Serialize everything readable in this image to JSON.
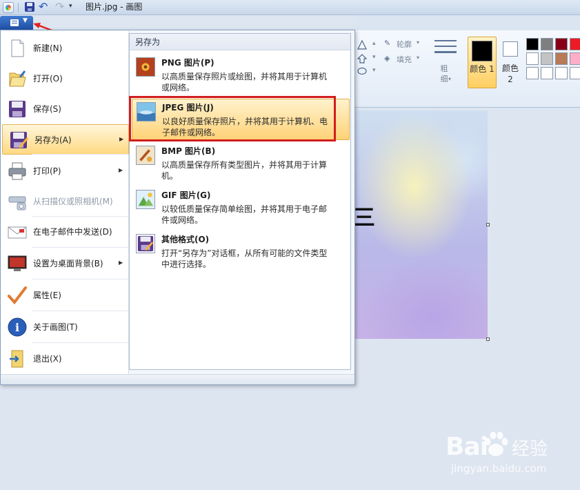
{
  "window": {
    "title": "图片.jpg - 画图",
    "icons": [
      "paint-app-icon",
      "save-icon",
      "undo-icon",
      "redo-icon",
      "customize-dropdown-icon"
    ]
  },
  "ribbon": {
    "outline_label": "轮廓",
    "fill_label": "填充",
    "sizes_label": "粗细",
    "color1_label": "颜色 1",
    "color2_label": "颜色 2",
    "color1_value": "#000000",
    "color2_value": "#ffffff",
    "palette": [
      "#000000",
      "#7f7f7f",
      "#880015",
      "#ed1c24",
      "#ffffff",
      "#c3c3c3",
      "#b97a57",
      "#ffaec9",
      "#ffffff",
      "#ffffff",
      "#ffffff",
      "#ffffff"
    ]
  },
  "canvas": {
    "visible_text": "三"
  },
  "app_menu": {
    "items": [
      {
        "label": "新建(N)",
        "icon": "new-file-icon"
      },
      {
        "label": "打开(O)",
        "icon": "open-folder-icon"
      },
      {
        "label": "保存(S)",
        "icon": "save-icon"
      },
      {
        "label": "另存为(A)",
        "icon": "save-as-icon",
        "selected": true,
        "has_submenu": true
      },
      {
        "label": "打印(P)",
        "icon": "printer-icon",
        "has_submenu": true
      },
      {
        "label": "从扫描仪或照相机(M)",
        "icon": "scanner-icon",
        "disabled": true
      },
      {
        "label": "在电子邮件中发送(D)",
        "icon": "email-icon"
      },
      {
        "label": "设置为桌面背景(B)",
        "icon": "desktop-background-icon",
        "has_submenu": true
      },
      {
        "label": "属性(E)",
        "icon": "checkmark-icon"
      },
      {
        "label": "关于画图(T)",
        "icon": "info-icon"
      },
      {
        "label": "退出(X)",
        "icon": "exit-icon"
      }
    ]
  },
  "save_as_submenu": {
    "header": "另存为",
    "items": [
      {
        "title": "PNG 图片(P)",
        "desc": "以高质量保存照片或绘图，并将其用于计算机或网络。",
        "icon": "png-image-icon"
      },
      {
        "title": "JPEG 图片(J)",
        "desc": "以良好质量保存照片，并将其用于计算机、电子邮件或网络。",
        "icon": "jpeg-image-icon",
        "highlighted": true
      },
      {
        "title": "BMP 图片(B)",
        "desc": "以高质量保存所有类型图片，并将其用于计算机。",
        "icon": "bmp-image-icon"
      },
      {
        "title": "GIF 图片(G)",
        "desc": "以较低质量保存简单绘图，并将其用于电子邮件或网络。",
        "icon": "gif-image-icon"
      },
      {
        "title": "其他格式(O)",
        "desc": "打开“另存为”对话框，从所有可能的文件类型中进行选择。",
        "icon": "other-format-icon"
      }
    ]
  },
  "watermark": {
    "logo": "Bai",
    "logo_suffix": "经验",
    "url": "jingyan.baidu.com"
  }
}
